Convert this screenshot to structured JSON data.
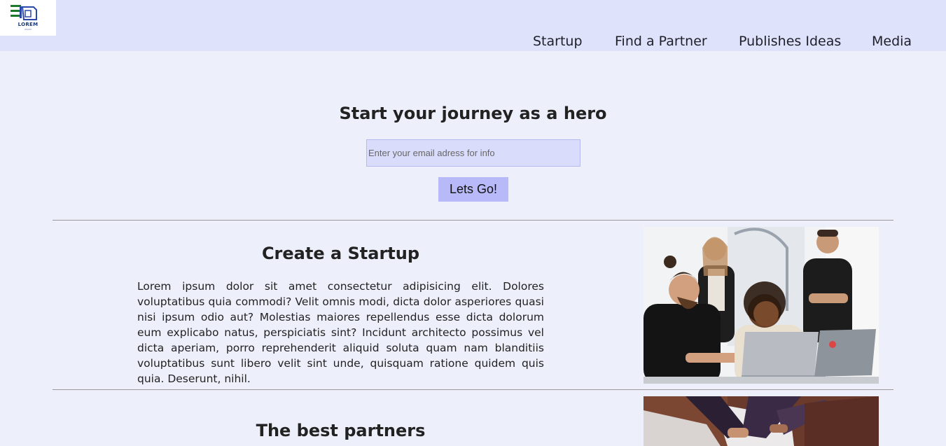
{
  "header": {
    "logo": {
      "text": "LOREM",
      "subtext": "IPSUM",
      "icon": "building-logo-icon"
    },
    "nav": [
      "Startup",
      "Find a Partner",
      "Publishes Ideas",
      "Media"
    ]
  },
  "hero": {
    "title": "Start your journey as a hero",
    "email_placeholder": "Enter your email adress for info",
    "button_label": "Lets Go!"
  },
  "sections": [
    {
      "title": "Create a Startup",
      "body": "Lorem ipsum dolor sit amet consectetur adipisicing elit. Dolores voluptatibus quia commodi? Velit omnis modi, dicta dolor asperiores quasi nisi ipsum odio aut? Molestias maiores repellendus esse dicta dolorum eum explicabo natus, perspiciatis sint? Incidunt architecto possimus vel dicta aperiam, porro reprehenderit aliquid soluta quam nam blanditiis voluptatibus sunt libero velit sint unde, quisquam ratione quidem quis quia. Deserunt, nihil.",
      "image": "team-laptops-photo"
    },
    {
      "title": "The best partners",
      "image": "hands-teamwork-photo"
    }
  ],
  "colors": {
    "header_bg": "#dfe2fb",
    "page_bg": "#edf0fb",
    "input_bg": "#dadcfb",
    "button_bg": "#b7b9f8"
  }
}
